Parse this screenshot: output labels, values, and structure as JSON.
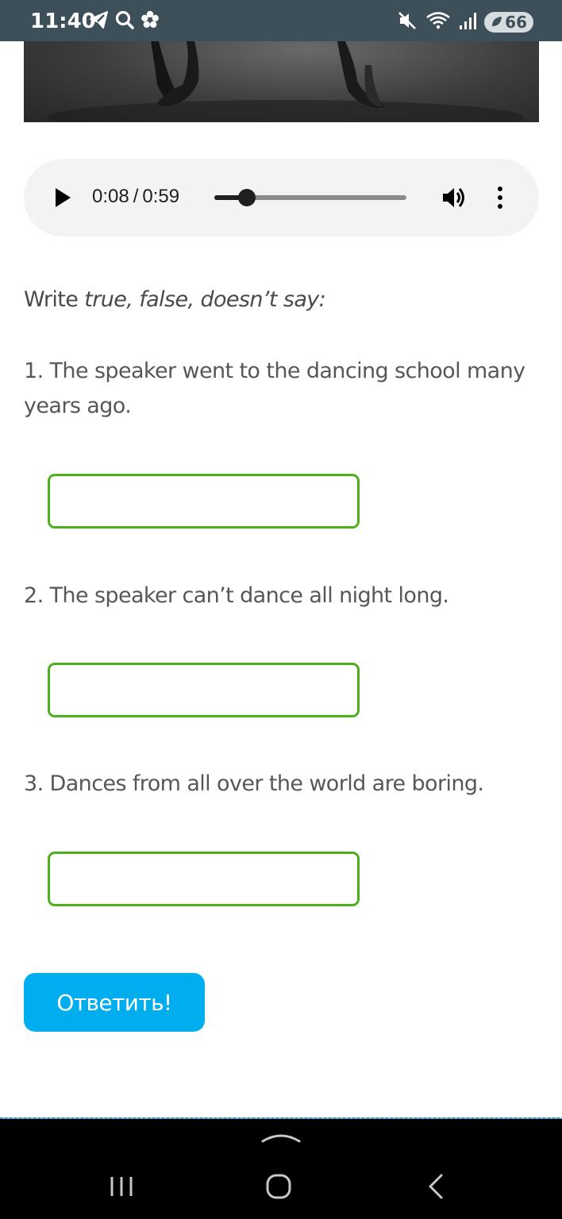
{
  "status_bar": {
    "time": "11:40",
    "battery": "66",
    "left_icons": [
      "telegram-icon",
      "search-icon",
      "flower-icon"
    ],
    "right_icons": [
      "mute-icon",
      "wifi-icon",
      "signal-icon",
      "battery-saver-icon"
    ]
  },
  "audio": {
    "current_time": "0:08",
    "separator": "/",
    "duration": "0:59",
    "progress_fraction": 0.17
  },
  "instruction": {
    "prefix": "Write",
    "italic": "true, false, doesn’t say:"
  },
  "questions": [
    {
      "text": "1. The speaker went to the dancing school many years ago.",
      "answer": ""
    },
    {
      "text": "2. The speaker can’t dance all night long.",
      "answer": ""
    },
    {
      "text": "3. Dances from all over the world are boring.",
      "answer": ""
    }
  ],
  "submit_label": "Ответить!",
  "colors": {
    "status_bar": "#3d4f59",
    "input_border": "#4caf1d",
    "submit_button": "#00aeef",
    "player_background": "#f1f3f4"
  },
  "nav_icons": [
    "chevron-up-icon",
    "recents-icon",
    "home-icon",
    "back-icon"
  ]
}
